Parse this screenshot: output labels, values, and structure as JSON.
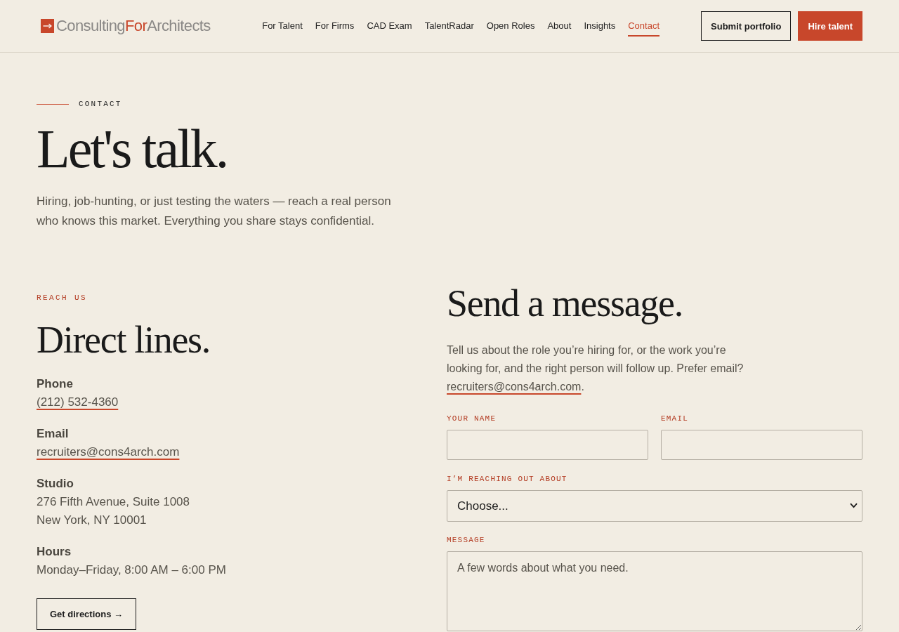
{
  "header": {
    "logo": {
      "before": "Consulting",
      "accent": "For",
      "after": "Architects"
    },
    "nav": [
      {
        "label": "For Talent",
        "selected": false
      },
      {
        "label": "For Firms",
        "selected": false
      },
      {
        "label": "CAD Exam",
        "selected": false
      },
      {
        "label": "TalentRadar",
        "selected": false
      },
      {
        "label": "Open Roles",
        "selected": false
      },
      {
        "label": "About",
        "selected": false
      },
      {
        "label": "Insights",
        "selected": false
      },
      {
        "label": "Contact",
        "selected": true
      }
    ],
    "actions": [
      {
        "label": "Submit portfolio",
        "kind": "outline"
      },
      {
        "label": "Hire talent",
        "kind": "primary"
      }
    ]
  },
  "hero": {
    "eyebrow": "CONTACT",
    "title": "Let's talk.",
    "lede": "Hiring, job-hunting, or just testing the waters — reach a real person who knows this market. Everything you share stays confidential."
  },
  "direct_lines": {
    "eyebrow": "REACH US",
    "title": "Direct lines.",
    "items": [
      {
        "label": "Phone",
        "kind": "link",
        "lines": [
          "(212) 532-4360"
        ]
      },
      {
        "label": "Email",
        "kind": "link",
        "lines": [
          "recruiters@cons4arch.com"
        ]
      },
      {
        "label": "Studio",
        "kind": "text",
        "lines": [
          "276 Fifth Avenue, Suite 1008",
          "New York, NY 10001"
        ]
      },
      {
        "label": "Hours",
        "kind": "text",
        "lines": [
          "Monday–Friday, 8:00 AM – 6:00 PM"
        ]
      }
    ],
    "button": "Get directions →"
  },
  "message_form": {
    "title": "Send a message.",
    "intro": "Tell us about the role you’re hiring for, or the work you’re looking for, and the right person will follow up. Prefer email?",
    "intro_link": "recruiters@cons4arch.com",
    "intro_end": ".",
    "fields": [
      {
        "label": "YOUR NAME"
      },
      {
        "label": "EMAIL"
      }
    ],
    "topic": {
      "label": "I’M REACHING OUT ABOUT",
      "value": "Choose..."
    },
    "message": {
      "label": "MESSAGE",
      "placeholder": "A few words about what you need."
    }
  }
}
